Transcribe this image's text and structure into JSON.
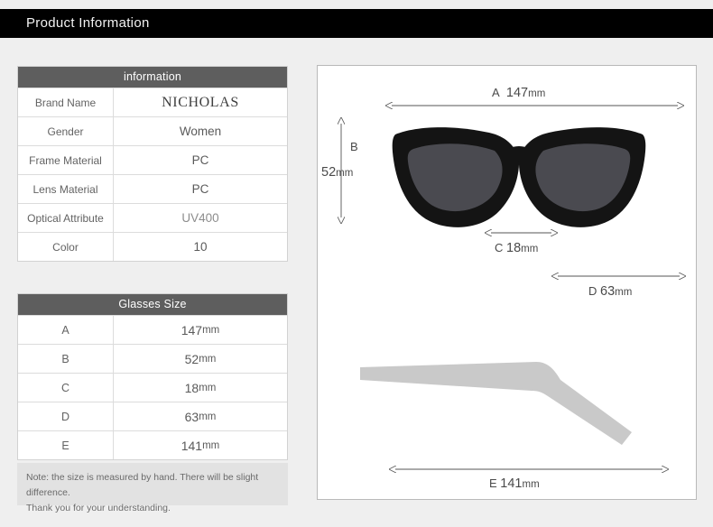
{
  "header": {
    "title": "Product Information"
  },
  "info_table": {
    "heading": "information",
    "rows": [
      {
        "key": "Brand Name",
        "value": "NICHOLAS"
      },
      {
        "key": "Gender",
        "value": "Women"
      },
      {
        "key": "Frame Material",
        "value": "PC"
      },
      {
        "key": "Lens Material",
        "value": "PC"
      },
      {
        "key": "Optical Attribute",
        "value": "UV400"
      },
      {
        "key": "Color",
        "value": "10"
      }
    ]
  },
  "size_table": {
    "heading": "Glasses Size",
    "rows": [
      {
        "key": "A",
        "num": "147",
        "unit": "mm"
      },
      {
        "key": "B",
        "num": "52",
        "unit": "mm"
      },
      {
        "key": "C",
        "num": "18",
        "unit": "mm"
      },
      {
        "key": "D",
        "num": "63",
        "unit": "mm"
      },
      {
        "key": "E",
        "num": "141",
        "unit": "mm"
      }
    ]
  },
  "note": {
    "line1": "Note: the size is measured by hand. There will be slight difference.",
    "line2": "Thank you for your understanding."
  },
  "diagram": {
    "labels": {
      "a_letter": "A",
      "a_num": "147",
      "a_unit": "mm",
      "b_letter": "B",
      "b_num": "52",
      "b_unit": "mm",
      "c_letter": "C",
      "c_num": "18",
      "c_unit": "mm",
      "d_letter": "D",
      "d_num": "63",
      "d_unit": "mm",
      "e_letter": "E",
      "e_num": "141",
      "e_unit": "mm"
    }
  },
  "colors": {
    "page_bg": "#efefef",
    "header_bg": "#000000",
    "table_header_bg": "#5e5e5e",
    "frame_black": "#141414",
    "lens_gray": "#4a4a50",
    "temple_gray": "#c9c9c9",
    "note_bg": "#e2e2e2"
  }
}
